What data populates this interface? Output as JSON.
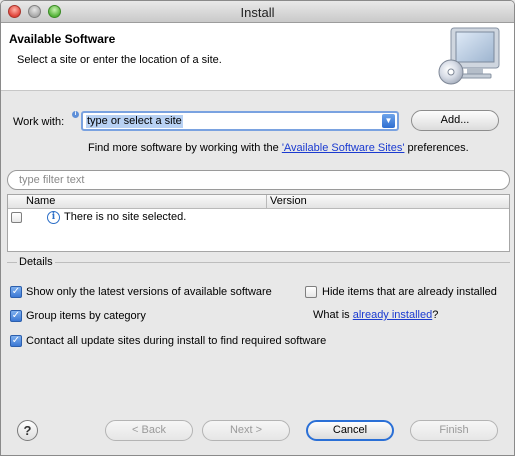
{
  "window": {
    "title": "Install"
  },
  "header": {
    "title": "Available Software",
    "description": "Select a site or enter the location of a site."
  },
  "work_with": {
    "label": "Work with:",
    "combo_value": "type or select a site",
    "add_button": "Add..."
  },
  "more_software": {
    "prefix": "Find more software by working with the ",
    "link": "'Available Software Sites'",
    "suffix": " preferences."
  },
  "filter": {
    "placeholder": "type filter text"
  },
  "table": {
    "columns": [
      "Name",
      "Version"
    ],
    "rows": [
      {
        "text": "There is no site selected.",
        "checked": false
      }
    ]
  },
  "details": {
    "label": "Details",
    "options": [
      {
        "label": "Show only the latest versions of available software",
        "checked": true
      },
      {
        "label": "Hide items that are already installed",
        "checked": false
      },
      {
        "label": "Group items by category",
        "checked": true
      },
      {
        "label": "Contact all update sites during install to find required software",
        "checked": true
      }
    ],
    "what_is": {
      "prefix": "What is ",
      "link": "already installed",
      "suffix": "?"
    }
  },
  "buttons": {
    "back": "< Back",
    "next": "Next >",
    "cancel": "Cancel",
    "finish": "Finish"
  },
  "icons": {
    "help": "help-icon",
    "monitor": "monitor-cd-icon",
    "info": "info-icon"
  },
  "colors": {
    "accent": "#2a6fd6",
    "link": "#1a3ad0",
    "selection": "#b8d1f3"
  }
}
